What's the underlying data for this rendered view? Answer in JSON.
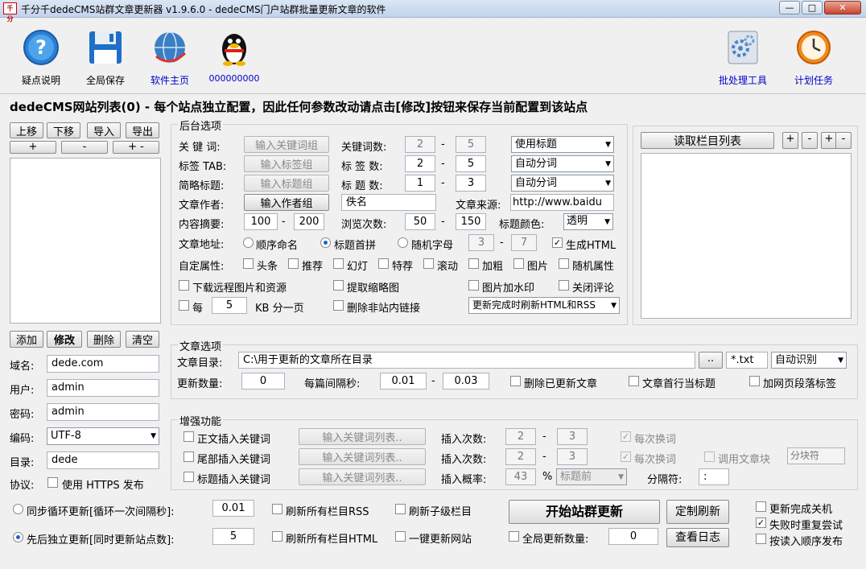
{
  "window": {
    "title": "千分千dedeCMS站群文章更新器 v1.9.6.0 - dedeCMS门户站群批量更新文章的软件",
    "icon": "app-icon",
    "minimize": "—",
    "maximize": "□",
    "close": "✕"
  },
  "toolbar": {
    "help": "疑点说明",
    "save": "全局保存",
    "home": "软件主页",
    "qq": "000000000",
    "batch": "批处理工具",
    "schedule": "计划任务"
  },
  "header": "dedeCMS网站列表(0) - 每个站点独立配置，因此任何参数改动请点击[修改]按钮来保存当前配置到该站点",
  "sitelist": {
    "up": "上移",
    "down": "下移",
    "import": "导入",
    "export": "导出",
    "plus": "+",
    "minus": "-",
    "plusminus": "+ -",
    "add": "添加",
    "edit": "修改",
    "delete": "删除",
    "clear": "清空"
  },
  "site": {
    "domain_label": "域名:",
    "domain": "dede.com",
    "user_label": "用户:",
    "user": "admin",
    "pass_label": "密码:",
    "pass": "admin",
    "enc_label": "编码:",
    "enc": "UTF-8",
    "dir_label": "目录:",
    "dir": "dede",
    "proto_label": "协议:",
    "https_label": "使用 HTTPS 发布"
  },
  "backend": {
    "title": "后台选项",
    "kw_label": "关 键 词:",
    "kw_btn": "输入关键词组",
    "kwcount_label": "关键词数:",
    "kw_min": "2",
    "kw_max": "5",
    "kw_mode": "使用标题",
    "tag_label": "标签 TAB:",
    "tag_btn": "输入标签组",
    "tagcount_label": "标 签 数:",
    "tag_min": "2",
    "tag_max": "5",
    "tag_mode": "自动分词",
    "short_label": "简略标题:",
    "short_btn": "输入标题组",
    "titlecount_label": "标 题 数:",
    "title_min": "1",
    "title_max": "3",
    "title_mode": "自动分词",
    "author_label": "文章作者:",
    "author_btn": "输入作者组",
    "author": "佚名",
    "source_label": "文章来源:",
    "source": "http://www.baidu",
    "summary_label": "内容摘要:",
    "sum_min": "100",
    "sum_max": "200",
    "views_label": "浏览次数:",
    "views_min": "50",
    "views_max": "150",
    "color_label": "标题颜色:",
    "color": "透明",
    "url_label": "文章地址:",
    "url_opt1": "顺序命名",
    "url_opt2": "标题首拼",
    "url_opt3": "随机字母",
    "rand_min": "3",
    "rand_max": "7",
    "gen_html": "生成HTML",
    "attr_label": "自定属性:",
    "attrs": [
      "头条",
      "推荐",
      "幻灯",
      "特荐",
      "滚动",
      "加粗",
      "图片",
      "随机属性"
    ],
    "dl_images": "下载远程图片和资源",
    "thumb": "提取缩略图",
    "watermark": "图片加水印",
    "close_comment": "关闭评论",
    "every": "每",
    "kb": "5",
    "kb_unit": "KB 分一页",
    "del_links": "删除非站内链接",
    "refresh_mode": "更新完成时刷新HTML和RSS",
    "dash": "-"
  },
  "column": {
    "read_btn": "读取栏目列表",
    "b1": "+",
    "b2": "-",
    "b3": "+",
    "b4": "-"
  },
  "article": {
    "title": "文章选项",
    "dir_label": "文章目录:",
    "dir": "C:\\用于更新的文章所在目录",
    "browse": "..",
    "ext": "*.txt",
    "enc": "自动识别",
    "count_label": "更新数量:",
    "count": "0",
    "interval_label": "每篇间隔秒:",
    "int_min": "0.01",
    "int_max": "0.03",
    "del_updated": "删除已更新文章",
    "first_line": "文章首行当标题",
    "para_tag": "加网页段落标签"
  },
  "enhance": {
    "title": "增强功能",
    "body_kw": "正文插入关键词",
    "tail_kw": "尾部插入关键词",
    "title_kw": "标题插入关键词",
    "kw_list": "输入关键词列表..",
    "times_label": "插入次数:",
    "t1_min": "2",
    "t1_max": "3",
    "t2_min": "2",
    "t2_max": "3",
    "prob_label": "插入概率:",
    "prob": "43",
    "pct": "%",
    "pos": "标题前",
    "swap": "每次换词",
    "use_block": "调用文章块",
    "block": "分块符",
    "sep_label": "分隔符:",
    "sep": ":"
  },
  "bottom": {
    "sync": "同步循环更新[循环一次间隔秒]:",
    "sync_val": "0.01",
    "seq": "先后独立更新[同时更新站点数]:",
    "seq_val": "5",
    "rss": "刷新所有栏目RSS",
    "subcol": "刷新子级栏目",
    "html": "刷新所有栏目HTML",
    "onekey": "一键更新网站",
    "start": "开始站群更新",
    "custom": "定制刷新",
    "log": "查看日志",
    "global_count": "全局更新数量:",
    "global_val": "0",
    "shutdown": "更新完成关机",
    "retry": "失败时重复尝试",
    "order": "按读入顺序发布"
  },
  "colors": {
    "link": "#0000cc",
    "accent": "#1e63c9"
  }
}
